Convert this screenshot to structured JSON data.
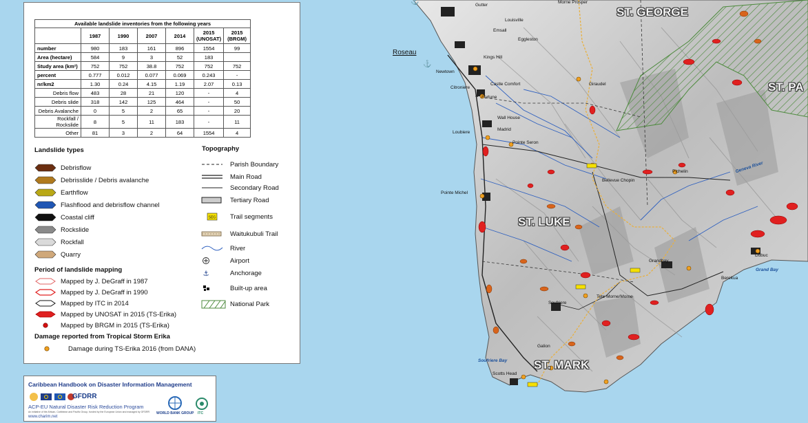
{
  "inventory_table": {
    "title": "Available landslide inventories from the following years",
    "columns": [
      "1987",
      "1990",
      "2007",
      "2014",
      "2015 (UNOSAT)",
      "2015 (BRGM)"
    ],
    "rows": [
      {
        "label": "number",
        "values": [
          "980",
          "183",
          "161",
          "896",
          "1554",
          "99"
        ]
      },
      {
        "label": "Area (hectare)",
        "values": [
          "584",
          "9",
          "3",
          "52",
          "183",
          ""
        ]
      },
      {
        "label": "Study area (km²)",
        "values": [
          "752",
          "752",
          "38.8",
          "752",
          "752",
          "752"
        ]
      },
      {
        "label": "percent",
        "values": [
          "0.777",
          "0.012",
          "0.077",
          "0.069",
          "0.243",
          "-"
        ]
      },
      {
        "label": "nr/km2",
        "values": [
          "1.30",
          "0.24",
          "4.15",
          "1.19",
          "2.07",
          "0.13"
        ]
      },
      {
        "label": "Debris flow",
        "values": [
          "483",
          "28",
          "21",
          "120",
          "-",
          "4"
        ]
      },
      {
        "label": "Debris slide",
        "values": [
          "318",
          "142",
          "125",
          "464",
          "-",
          "50"
        ]
      },
      {
        "label": "Debris Avalanche",
        "values": [
          "0",
          "5",
          "2",
          "65",
          "-",
          "20"
        ]
      },
      {
        "label": "Rockfall / Rockslide",
        "values": [
          "8",
          "5",
          "11",
          "183",
          "-",
          "11"
        ]
      },
      {
        "label": "Other",
        "values": [
          "81",
          "3",
          "2",
          "64",
          "1554",
          "4"
        ]
      }
    ]
  },
  "landslide_types": {
    "heading": "Landslide types",
    "items": [
      {
        "label": "Debrisflow",
        "color": "#6b2e10"
      },
      {
        "label": "Debrisslide / Debris avalanche",
        "color": "#b07a1e"
      },
      {
        "label": "Earthflow",
        "color": "#b9a816"
      },
      {
        "label": "Flashflood and debrisflow channel",
        "color": "#1f56b4"
      },
      {
        "label": "Coastal cliff",
        "color": "#111111"
      },
      {
        "label": "Rockslide",
        "color": "#8a8a8a"
      },
      {
        "label": "Rockfall",
        "color": "#dadada"
      },
      {
        "label": "Quarry",
        "color": "#cfa87a"
      }
    ]
  },
  "mapping_period": {
    "heading": "Period of landslide mapping",
    "items": [
      {
        "label": "Mapped by J. DeGraff in 1987"
      },
      {
        "label": "Mapped by J. DeGraff in 1990"
      },
      {
        "label": "Mapped by ITC in 2014"
      },
      {
        "label": "Mapped by UNOSAT  in 2015 (TS-Erika)"
      },
      {
        "label": "Mapped by BRGM in 2015 (TS-Erika)"
      }
    ]
  },
  "damage": {
    "heading": "Damage reported from Tropical Storm Erika",
    "item": "Damage during TS-Erika 2016 (from DANA)",
    "color": "#f0a020"
  },
  "topography": {
    "heading": "Topography",
    "items": [
      {
        "label": "Parish Boundary",
        "icon": "dashed-line-icon"
      },
      {
        "label": "Main Road",
        "icon": "double-line-icon"
      },
      {
        "label": "Secondary Road",
        "icon": "single-line-icon"
      },
      {
        "label": "Tertiary Road",
        "icon": "box-road-icon"
      },
      {
        "label": "Trail segments",
        "icon": "trail-segment-icon",
        "badge": "SEG"
      },
      {
        "label": "Waitukubuli Trail",
        "icon": "trail-icon"
      },
      {
        "label": "River",
        "icon": "river-icon"
      },
      {
        "label": "Airport",
        "icon": "airport-icon"
      },
      {
        "label": "Anchorage",
        "icon": "anchor-icon"
      },
      {
        "label": "Built-up area",
        "icon": "builtup-icon"
      },
      {
        "label": "National Park",
        "icon": "national-park-icon"
      }
    ]
  },
  "credits": {
    "title": "Caribbean Handbook on Disaster Information Management",
    "program": "ACP-EU Natural Disaster Risk Reduction Program",
    "small": "An initiative of the African, Caribbean and Pacific Group, funded by the European Union and managed by GFDRR",
    "url": "www.charim.net",
    "gfdrr": "GFDRR",
    "wbg": "WORLD BANK GROUP",
    "itc": "ITC"
  },
  "map_labels": {
    "parishes": [
      "ST. GEORGE",
      "ST. LUKE",
      "ST. MARK",
      "ST. PA"
    ],
    "places": [
      "Roseau",
      "Newtown",
      "Citroniere",
      "Loubiere",
      "Pointe Michel",
      "Soufriere",
      "Scotts Head",
      "Galion",
      "Tete Morne/Morne",
      "Grandbay",
      "Berekua",
      "Dubuc",
      "Pichelin",
      "Bellevue Chopin",
      "Fortune",
      "Castle Comfort",
      "Wall House",
      "Madrid",
      "Pointe Seron",
      "Giraudel",
      "Eggleston",
      "Louisville",
      "Emsall",
      "Morne Prosper",
      "Gutter",
      "Kings Hill"
    ],
    "bays": [
      "Soufriere Bay",
      "Grand Bay",
      "Geneva River"
    ]
  }
}
